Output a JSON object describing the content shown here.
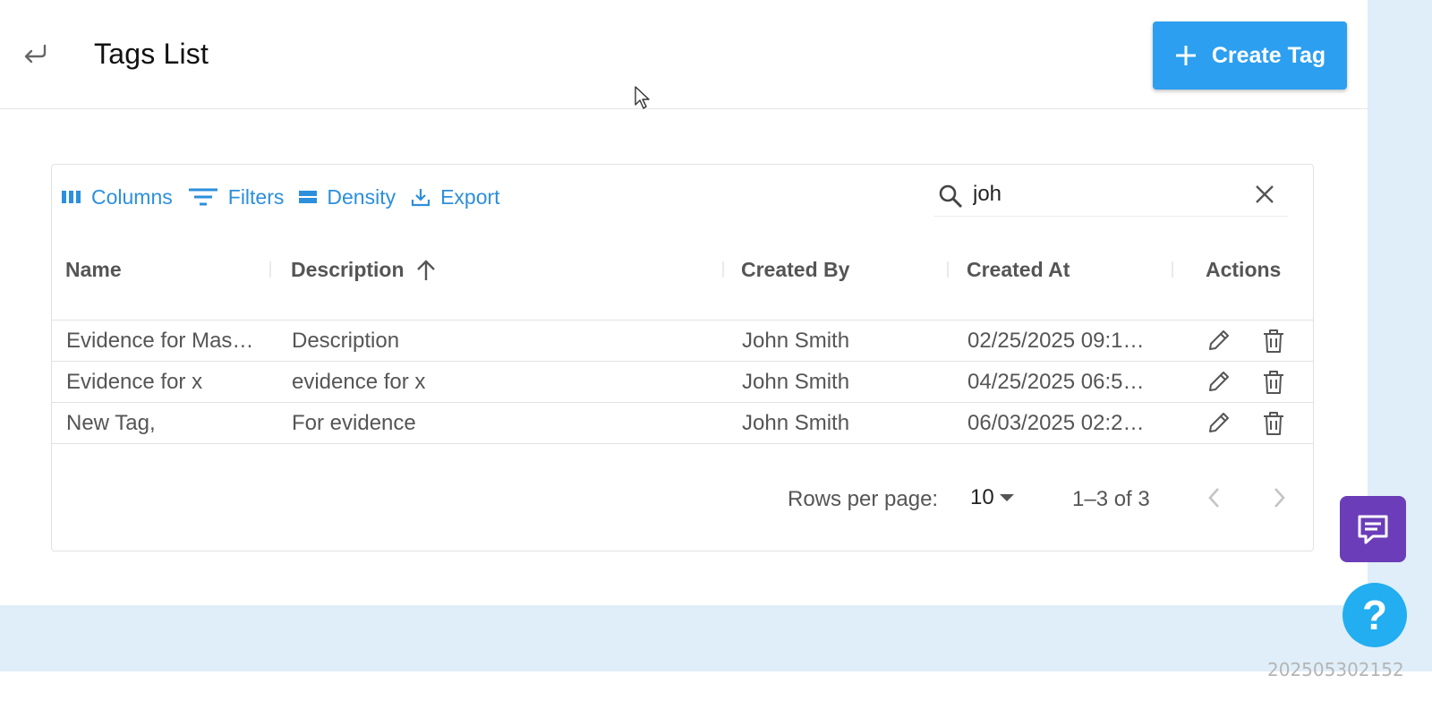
{
  "header": {
    "title": "Tags List",
    "create_label": "Create Tag"
  },
  "toolbar": {
    "columns": "Columns",
    "filters": "Filters",
    "density": "Density",
    "export": "Export"
  },
  "search": {
    "value": "joh"
  },
  "table": {
    "columns": [
      "Name",
      "Description",
      "Created By",
      "Created At",
      "Actions"
    ],
    "sorted_column": "Description",
    "sort_direction": "ascending",
    "rows": [
      {
        "name": "Evidence for Mas…",
        "description": "Description",
        "created_by": "John Smith",
        "created_at": "02/25/2025 09:1…"
      },
      {
        "name": "Evidence for x",
        "description": "evidence for x",
        "created_by": "John Smith",
        "created_at": "04/25/2025 06:5…"
      },
      {
        "name": "New Tag,",
        "description": "For evidence",
        "created_by": "John Smith",
        "created_at": "06/03/2025 02:2…"
      }
    ]
  },
  "pagination": {
    "rows_per_page_label": "Rows per page:",
    "rows_per_page": "10",
    "range": "1–3 of 3"
  },
  "widgets": {
    "help_glyph": "?"
  },
  "watermark": "202505302152",
  "colors": {
    "accent": "#2c9ff0",
    "link": "#2c8fdc",
    "chat": "#6b3db8",
    "help": "#22aef0"
  }
}
